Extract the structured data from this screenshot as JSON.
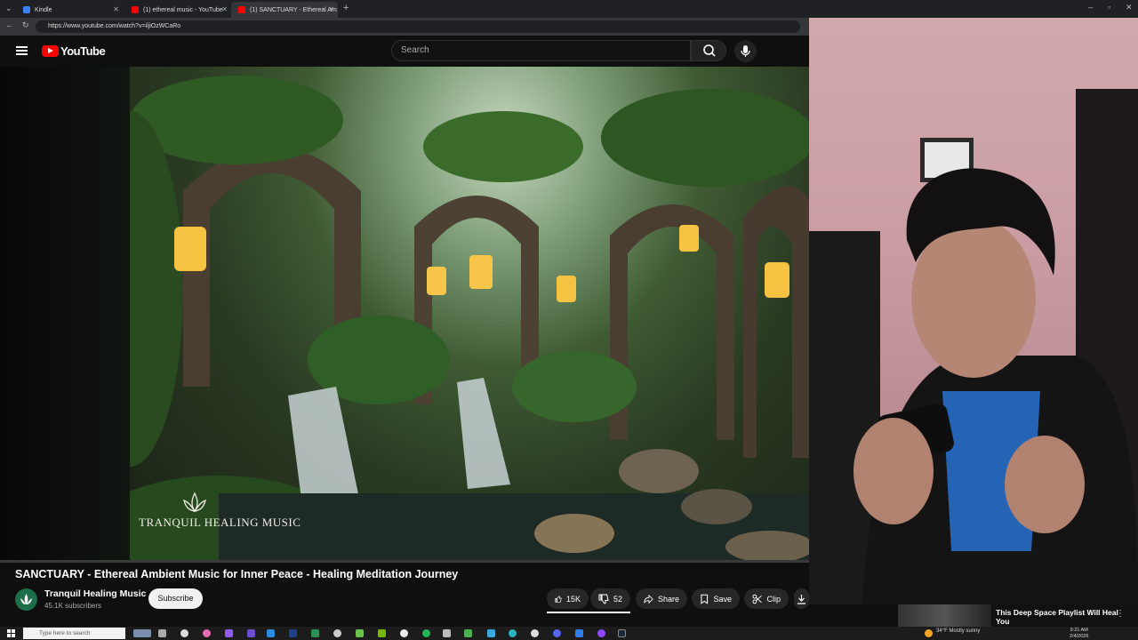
{
  "browser": {
    "tabs": [
      {
        "title": "Kindle",
        "color": "#3b82f6"
      },
      {
        "title": "(1) ethereal music - YouTube",
        "color": "#ff0000"
      },
      {
        "title": "(1) SANCTUARY - Ethereal Am",
        "color": "#ff0000"
      }
    ],
    "new_tab": "+",
    "url": "https://www.youtube.com/watch?v=iljiOzWCaRo"
  },
  "youtube": {
    "logo_text": "YouTube",
    "search_placeholder": "Search"
  },
  "video": {
    "watermark": "TRANQUIL HEALING MUSIC",
    "title": "SANCTUARY - Ethereal Ambient Music for Inner Peace - Healing Meditation Journey",
    "channel_name": "Tranquil Healing Music",
    "subscribers": "45.1K subscribers",
    "subscribe_label": "Subscribe",
    "likes": "15K",
    "dislikes": "52",
    "share_label": "Share",
    "save_label": "Save",
    "clip_label": "Clip"
  },
  "notification": {
    "title": "This Deep Space Playlist Will Heal You",
    "menu": "⋮"
  },
  "taskbar": {
    "search_placeholder": "Type here to search",
    "weather": "34°F  Mostly sunny",
    "time": "9:21 AM",
    "date": "2/4/2026"
  },
  "colors": {
    "youtube_red": "#ff0000",
    "background": "#0f0f0f",
    "button_bg": "#272727"
  }
}
